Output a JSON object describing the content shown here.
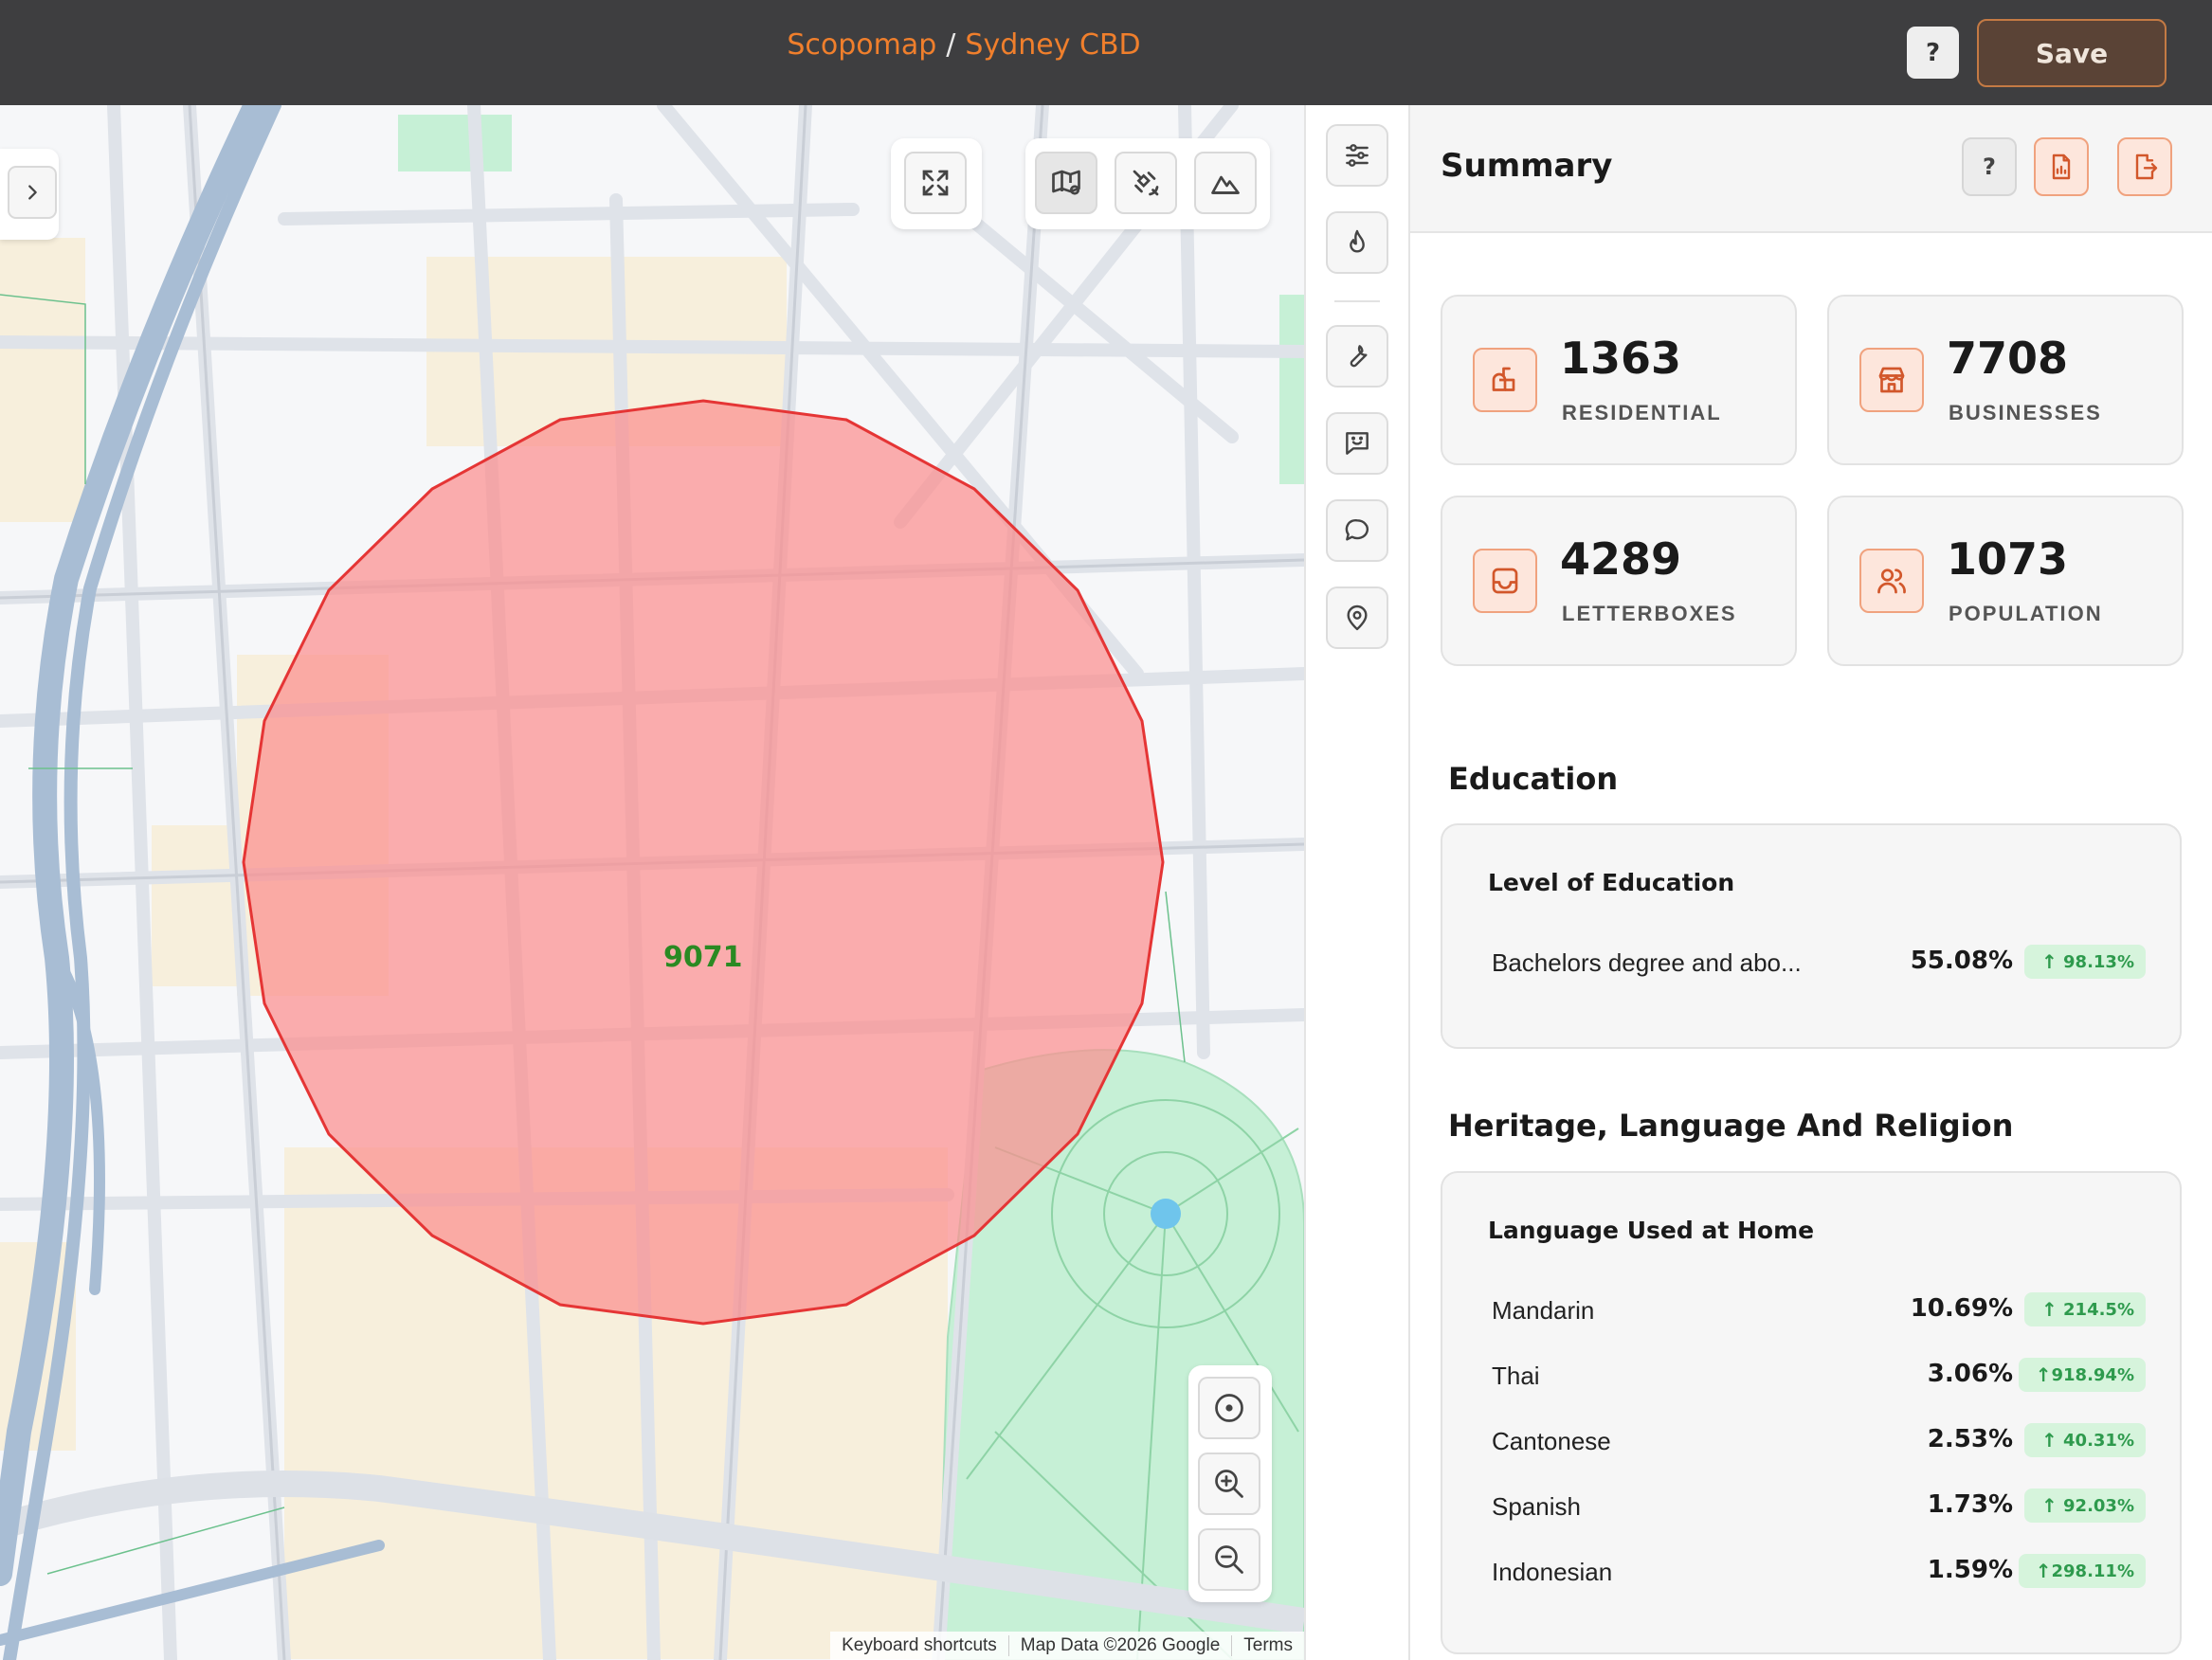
{
  "header": {
    "app_name": "Scopomap",
    "separator": "/",
    "location": "Sydney CBD",
    "help_label": "?",
    "save_label": "Save"
  },
  "map": {
    "polygon_label": "9071",
    "attribution": [
      "Keyboard shortcuts",
      "Map Data ©2026 Google",
      "Terms"
    ],
    "controls": {
      "fullscreen_icon": "expand-icon",
      "map_type_buttons": [
        "map-icon",
        "satellite-icon",
        "terrain-icon"
      ],
      "zoom_buttons": [
        "locate-icon",
        "zoom-in-icon",
        "zoom-out-icon"
      ]
    },
    "colors": {
      "polygon_fill": "#fb8f8f",
      "polygon_stroke": "#e53535",
      "park": "#c6f0d6",
      "roads": "#dde1e7",
      "highway": "#a8bdd4"
    }
  },
  "toolrail": {
    "icons": [
      "sliders-icon",
      "flame-icon",
      "wrench-icon",
      "message-smile-icon",
      "chat-bubble-icon",
      "map-pin-icon"
    ]
  },
  "panel": {
    "title": "Summary",
    "help_label": "?",
    "stats": [
      {
        "value": "1363",
        "label": "RESIDENTIAL",
        "icon": "mailbox-icon"
      },
      {
        "value": "7708",
        "label": "BUSINESSES",
        "icon": "store-icon"
      },
      {
        "value": "4289",
        "label": "LETTERBOXES",
        "icon": "inbox-icon"
      },
      {
        "value": "1073",
        "label": "POPULATION",
        "icon": "users-icon"
      }
    ],
    "education": {
      "title": "Education",
      "subtitle": "Level of Education",
      "rows": [
        {
          "name": "Bachelors degree and abo...",
          "pct": "55.08%",
          "change": "98.13%"
        }
      ]
    },
    "heritage": {
      "title": "Heritage, Language And Religion",
      "subtitle": "Language Used at Home",
      "rows": [
        {
          "name": "Mandarin",
          "pct": "10.69%",
          "change": "214.5%"
        },
        {
          "name": "Thai",
          "pct": "3.06%",
          "change": "918.94%"
        },
        {
          "name": "Cantonese",
          "pct": "2.53%",
          "change": "40.31%"
        },
        {
          "name": "Spanish",
          "pct": "1.73%",
          "change": "92.03%"
        },
        {
          "name": "Indonesian",
          "pct": "1.59%",
          "change": "298.11%"
        }
      ]
    },
    "accent": "#f07f2c",
    "badge_color": "#2e9a4d"
  }
}
